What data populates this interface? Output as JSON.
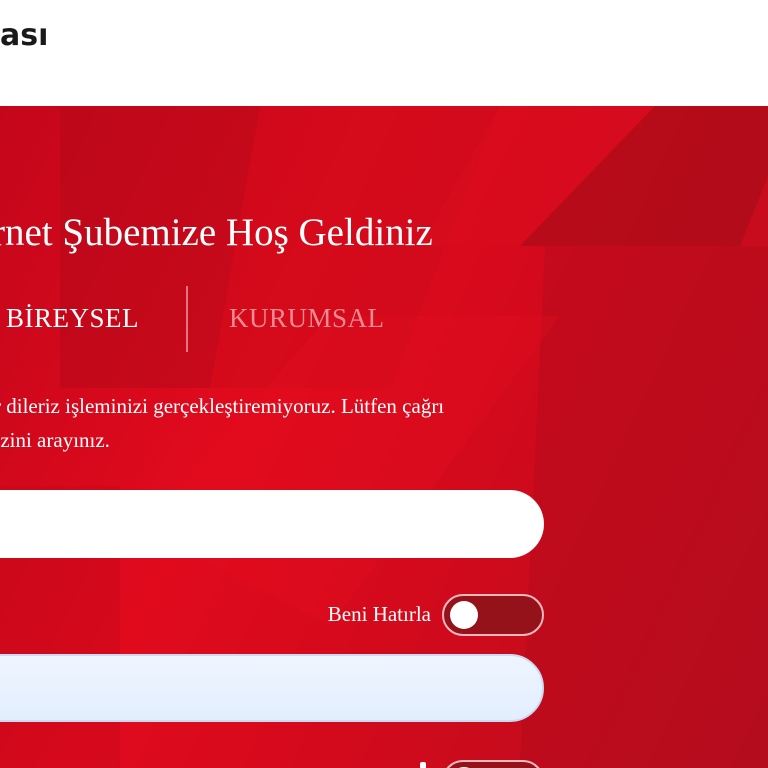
{
  "header": {
    "logo_text": "ası"
  },
  "hero": {
    "title": "rnet Şubemize Hoş Geldiniz",
    "tabs": [
      {
        "label": "BİREYSEL",
        "active": true
      },
      {
        "label": "KURUMSAL",
        "active": false
      }
    ],
    "error_message": {
      "line1": "r dileriz işleminizi gerçekleştiremiyoruz. Lütfen çağrı",
      "line2": "ezini arayınız."
    },
    "customer_input": {
      "value": "",
      "placeholder": ""
    },
    "remember_me": {
      "label": "Beni Hatırla",
      "checked": false
    },
    "password_input": {
      "value": "",
      "placeholder": ""
    }
  },
  "colors": {
    "brand_red": "#e10a1d",
    "toggle_bg": "#95121b",
    "inactive_tab": "#f08a93"
  }
}
